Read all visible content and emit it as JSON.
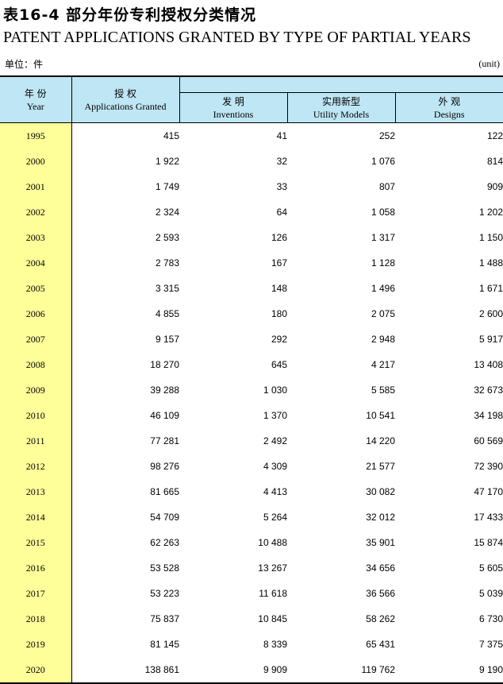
{
  "header": {
    "title_cn": "表16-4 部分年份专利授权分类情况",
    "title_en": "PATENT APPLICATIONS GRANTED BY TYPE OF PARTIAL YEARS",
    "unit_cn": "单位：件",
    "unit_en": "(unit)"
  },
  "columns": {
    "year_cn": "年 份",
    "year_en": "Year",
    "granted_cn": "授 权",
    "granted_en": "Applications Granted",
    "inventions_cn": "发 明",
    "inventions_en": "Inventions",
    "utility_cn": "实用新型",
    "utility_en": "Utility Models",
    "designs_cn": "外 观",
    "designs_en": "Designs"
  },
  "rows": [
    [
      "1995",
      "415",
      "41",
      "252",
      "122"
    ],
    [
      "2000",
      "1 922",
      "32",
      "1 076",
      "814"
    ],
    [
      "2001",
      "1 749",
      "33",
      "807",
      "909"
    ],
    [
      "2002",
      "2 324",
      "64",
      "1 058",
      "1 202"
    ],
    [
      "2003",
      "2 593",
      "126",
      "1 317",
      "1 150"
    ],
    [
      "2004",
      "2 783",
      "167",
      "1 128",
      "1 488"
    ],
    [
      "2005",
      "3 315",
      "148",
      "1 496",
      "1 671"
    ],
    [
      "2006",
      "4 855",
      "180",
      "2 075",
      "2 600"
    ],
    [
      "2007",
      "9 157",
      "292",
      "2 948",
      "5 917"
    ],
    [
      "2008",
      "18 270",
      "645",
      "4 217",
      "13 408"
    ],
    [
      "2009",
      "39 288",
      "1 030",
      "5 585",
      "32 673"
    ],
    [
      "2010",
      "46 109",
      "1 370",
      "10 541",
      "34 198"
    ],
    [
      "2011",
      "77 281",
      "2 492",
      "14 220",
      "60 569"
    ],
    [
      "2012",
      "98 276",
      "4 309",
      "21 577",
      "72 390"
    ],
    [
      "2013",
      "81 665",
      "4 413",
      "30 082",
      "47 170"
    ],
    [
      "2014",
      "54 709",
      "5 264",
      "32 012",
      "17 433"
    ],
    [
      "2015",
      "62 263",
      "10 488",
      "35 901",
      "15 874"
    ],
    [
      "2016",
      "53 528",
      "13 267",
      "34 656",
      "5 605"
    ],
    [
      "2017",
      "53 223",
      "11 618",
      "36 566",
      "5 039"
    ],
    [
      "2018",
      "75 837",
      "10 845",
      "58 262",
      "6 730"
    ],
    [
      "2019",
      "81 145",
      "8 339",
      "65 431",
      "7 375"
    ],
    [
      "2020",
      "138 861",
      "9 909",
      "119 762",
      "9 190"
    ]
  ],
  "colors": {
    "header_bg": "#bfe6f4",
    "year_col_bg": "#ffff99"
  }
}
